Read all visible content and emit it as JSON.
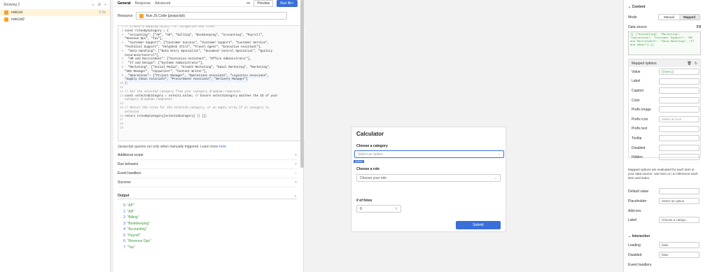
{
  "left": {
    "showing": "Showing 2",
    "queries": [
      {
        "name": "roleList",
        "time": "0.0s"
      },
      {
        "name": "roleList2",
        "time": ""
      }
    ]
  },
  "editor": {
    "tabs": [
      "General",
      "Response",
      "Advanced"
    ],
    "more": "•••",
    "preview": "Preview",
    "run": "Run",
    "run_shortcut": "⌘↵",
    "resource_label": "Resource",
    "resource_value": "Run JS Code (javascript)",
    "code": [
      {
        "n": "1",
        "t": "// Create a mapping object for categories and roles",
        "c": "cm"
      },
      {
        "n": "2",
        "t": "const rolesByCategory = {",
        "c": ""
      },
      {
        "n": "3",
        "t": "  \"Accounting\": [\"AP\", \"AR\", \"Billing\", \"Bookkeeping\", \"Accounting\", \"Payroll\",",
        "c": ""
      },
      {
        "n": "",
        "t": "\"Revenue Ops\", \"Tax\"],",
        "c": ""
      },
      {
        "n": "4",
        "t": "  \"Customer Support\": [\"Customer Success\", \"Customer Support\", \"Customer Service\",",
        "c": ""
      },
      {
        "n": "",
        "t": "\"Technical Support\", \"Helpdesk IT1/2\", \"Travel Agent\", \"Executive Assistant\"],",
        "c": ""
      },
      {
        "n": "5",
        "t": "  \"Data Handling\": [\"Data Entry Specialist\", \"Document Control Specialist\", \"Quality",
        "c": ""
      },
      {
        "n": "",
        "t": "Assurance/Control\"],",
        "c": ""
      },
      {
        "n": "6",
        "t": "  \"HR and Recruitment\": [\"Executive Assistant\", \"Office Administrator\"],",
        "c": ""
      },
      {
        "n": "7",
        "t": "  \"IT and Design\": [\"Systems Administrator\"],",
        "c": ""
      },
      {
        "n": "8",
        "t": "  \"Marketing\": [\"Social Media\", \"Growth Marketing\", \"Email Marketing\", \"Marketing\",",
        "c": ""
      },
      {
        "n": "",
        "t": "\"SEO Manager\", \"Copywriter\", \"Content Writer\"],",
        "c": ""
      },
      {
        "n": "9",
        "t": "  \"Operations\": [\"Project Manager\", \"Operations Associate\", \"Logistics Associate\",",
        "c": "hl"
      },
      {
        "n": "",
        "t": "\"Supply Chain Associate\", \"Procurement Associate\", \"Delivery Manager\"]",
        "c": "hl"
      },
      {
        "n": "10",
        "t": "};",
        "c": ""
      },
      {
        "n": "11",
        "t": "",
        "c": ""
      },
      {
        "n": "12",
        "t": "// Get the selected category from your category dropdown component",
        "c": "cm"
      },
      {
        "n": "13",
        "t": "const selectedCategory = select1.value; // Ensure selectCategory matches the ID of your",
        "c": ""
      },
      {
        "n": "",
        "t": "category dropdown component",
        "c": "cm"
      },
      {
        "n": "14",
        "t": "",
        "c": ""
      },
      {
        "n": "15",
        "t": "// Return the roles for the selected category, or an empty array if no category is",
        "c": "cm"
      },
      {
        "n": "",
        "t": "selected",
        "c": "cm"
      },
      {
        "n": "16",
        "t": "return rolesByCategory[selectedCategory] || [];",
        "c": ""
      },
      {
        "n": "17",
        "t": "",
        "c": ""
      },
      {
        "n": "18",
        "t": "",
        "c": ""
      },
      {
        "n": "19",
        "t": "",
        "c": ""
      }
    ],
    "note": "Javascript queries run only when manually triggered. Learn more ",
    "note_link": "here",
    "sections": [
      "Additional scope",
      "Run behavior",
      "Event handlers",
      "Success"
    ],
    "output_label": "Output",
    "output": [
      {
        "k": "0:",
        "v": "\"AP\""
      },
      {
        "k": "1:",
        "v": "\"AR\""
      },
      {
        "k": "2:",
        "v": "\"Billing\""
      },
      {
        "k": "3:",
        "v": "\"Bookkeeping\""
      },
      {
        "k": "4:",
        "v": "\"Accounting\""
      },
      {
        "k": "5:",
        "v": "\"Payroll\""
      },
      {
        "k": "6:",
        "v": "\"Revenue Ops\""
      },
      {
        "k": "7:",
        "v": "\"Tax\""
      }
    ]
  },
  "canvas": {
    "title": "Calculator",
    "cat_label": "Choose a category",
    "cat_placeholder": "Select an option",
    "badge": "select1",
    "role_label": "Choose a role",
    "role_placeholder": "Choose your role",
    "hires_label": "# of hires",
    "hires_value": "0",
    "submit": "Submit"
  },
  "right": {
    "content": "Content",
    "mode": "Mode",
    "manual": "Manual",
    "mapped": "Mapped",
    "data_source": "Data source",
    "fx": "FX",
    "ds_value": "{{ [\"Accounting\", \"Marketing\", \"Operations\", \"Customer Support\", \"HR and Recruitment\", \"Data Handling\", \"IT and Admin\"] }}",
    "mapped_options": "Mapped options",
    "rows": [
      {
        "l": "Value",
        "v": "{{ item }}"
      },
      {
        "l": "Label",
        "v": ""
      },
      {
        "l": "Caption",
        "v": ""
      },
      {
        "l": "Color",
        "v": ""
      },
      {
        "l": "Prefix image",
        "v": ""
      },
      {
        "l": "Prefix icon",
        "v": "Select an icon"
      },
      {
        "l": "Prefix text",
        "v": ""
      },
      {
        "l": "Tooltip",
        "v": ""
      },
      {
        "l": "Disabled",
        "v": ""
      },
      {
        "l": "Hidden",
        "v": ""
      }
    ],
    "mapped_note": "Mapped options are evaluated for each item in your data source. Use item or i to reference each item and index.",
    "default_value": "Default value",
    "placeholder": "Placeholder",
    "placeholder_value": "Select an option",
    "addons": "Add-ons",
    "label": "Label",
    "label_value": "Choose a catego...",
    "interaction": "Interaction",
    "loading": "Loading",
    "loading_value": "false",
    "disabled": "Disabled",
    "disabled_value": "false",
    "event_handlers": "Event handlers"
  }
}
